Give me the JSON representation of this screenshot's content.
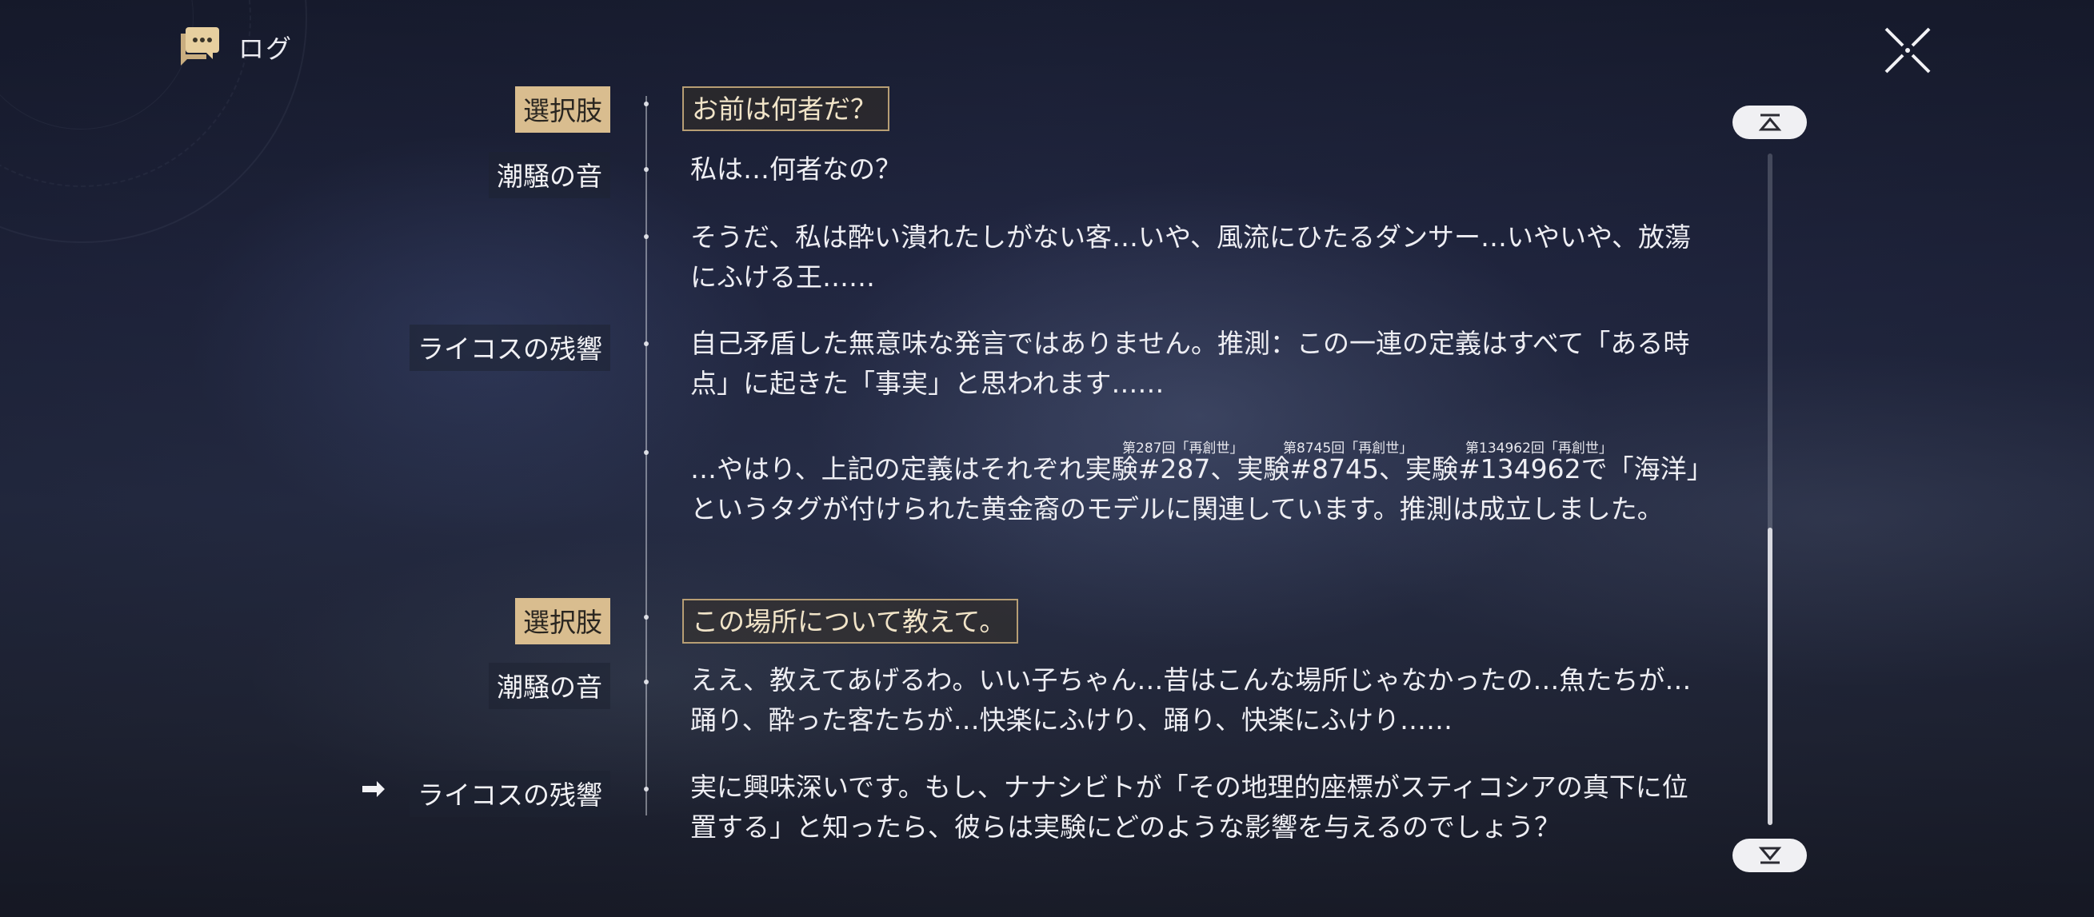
{
  "header": {
    "title": "ログ",
    "icon": "chat-bubble-icon",
    "close_icon": "close-icon"
  },
  "colors": {
    "choice_tag_bg": "#d9bd8f",
    "choice_border": "#b79e74",
    "text": "#eeeef3"
  },
  "entries": [
    {
      "type": "choice",
      "speaker": "選択肢",
      "text": "お前は何者だ？"
    },
    {
      "type": "line",
      "speaker": "潮騒の音",
      "text": "私は…何者なの？"
    },
    {
      "type": "line",
      "speaker": "",
      "text": "そうだ、私は酔い潰れたしがない客…いや、風流にひたるダンサー…いやいや、放蕩にふける王……"
    },
    {
      "type": "line",
      "speaker": "ライコスの残響",
      "text": "自己矛盾した無意味な発言ではありません。推測：この一連の定義はすべて「ある時点」に起きた「事実」と思われます……"
    },
    {
      "type": "line",
      "speaker": "",
      "text": "…やはり、上記の定義はそれぞれ実験#287、実験#8745、実験#134962で「海洋」というタグが付けられた黄金裔のモデルに関連しています。推測は成立しました。",
      "ruby": [
        "第287回「再創世」",
        "第8745回「再創世」",
        "第134962回「再創世」"
      ]
    },
    {
      "type": "choice",
      "speaker": "選択肢",
      "text": "この場所について教えて。"
    },
    {
      "type": "line",
      "speaker": "潮騒の音",
      "text": "ええ、教えてあげるわ。いい子ちゃん…昔はこんな場所じゃなかったの…魚たちが…踊り、酔った客たちが…快楽にふけり、踊り、快楽にふけり……"
    },
    {
      "type": "line",
      "speaker": "ライコスの残響",
      "text": "実に興味深いです。もし、ナナシビトが「その地理的座標がスティコシアの真下に位置する」と知ったら、彼らは実験にどのような影響を与えるのでしょう？",
      "current": true
    }
  ],
  "scroll": {
    "top_icon": "scroll-to-top-icon",
    "bottom_icon": "scroll-to-bottom-icon",
    "position_fraction": 0.56
  }
}
